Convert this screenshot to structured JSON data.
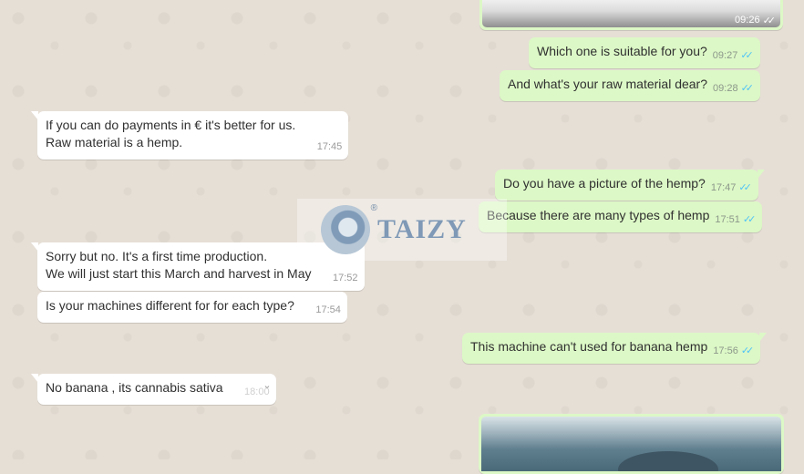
{
  "messages": [
    {
      "id": "m1",
      "dir": "out",
      "kind": "image",
      "time": "09:26"
    },
    {
      "id": "m2",
      "dir": "out",
      "lines": [
        "Which one is suitable for you?"
      ],
      "time": "09:27"
    },
    {
      "id": "m3",
      "dir": "out",
      "lines": [
        "And what's your raw material dear?"
      ],
      "time": "09:28"
    },
    {
      "id": "m4",
      "dir": "in",
      "lines": [
        "If you can do payments in € it's better for us.",
        "Raw material is a hemp."
      ],
      "time": "17:45"
    },
    {
      "id": "m5",
      "dir": "out",
      "lines": [
        "Do you have a picture of the hemp?"
      ],
      "time": "17:47"
    },
    {
      "id": "m6",
      "dir": "out",
      "lines": [
        "Because there are many types of hemp"
      ],
      "time": "17:51"
    },
    {
      "id": "m7",
      "dir": "in",
      "lines": [
        "Sorry but no. It's a first time production.",
        "We will just start this March and harvest in May"
      ],
      "time": "17:52"
    },
    {
      "id": "m8",
      "dir": "in",
      "lines": [
        "Is your machines different for for each type?"
      ],
      "time": "17:54"
    },
    {
      "id": "m9",
      "dir": "out",
      "lines": [
        "This machine can't used for banana hemp"
      ],
      "time": "17:56"
    },
    {
      "id": "m10",
      "dir": "in",
      "lines": [
        "No banana , its cannabis sativa"
      ],
      "time": "18:00"
    },
    {
      "id": "m11",
      "dir": "out",
      "kind": "image"
    }
  ],
  "read_ticks": "✓✓",
  "watermark": {
    "brand": "TAIZY",
    "reg": "®"
  },
  "colors": {
    "incoming": "#ffffff",
    "outgoing": "#dcf8c6",
    "tick": "#4fc3f7",
    "wallpaper": "#e6dfd6"
  }
}
